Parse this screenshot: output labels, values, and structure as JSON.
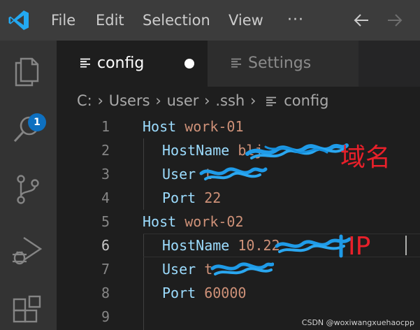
{
  "titlebar": {
    "menus": [
      "File",
      "Edit",
      "Selection",
      "View",
      "···"
    ],
    "back_icon": "arrow-left-icon",
    "forward_icon": "arrow-right-icon"
  },
  "activitybar": {
    "items": [
      {
        "name": "explorer-icon",
        "badge": "1"
      },
      {
        "name": "search-icon"
      },
      {
        "name": "source-control-icon"
      },
      {
        "name": "run-debug-icon"
      },
      {
        "name": "extensions-icon"
      }
    ]
  },
  "tabs": [
    {
      "label": "config",
      "active": true,
      "dirty": true
    },
    {
      "label": "Settings",
      "active": false
    }
  ],
  "breadcrumb": {
    "items": [
      "C:",
      "Users",
      "user",
      ".ssh",
      "config"
    ]
  },
  "editor": {
    "lines": [
      {
        "num": "1",
        "key": "Host",
        "value": "work-01",
        "indent": false
      },
      {
        "num": "2",
        "key": "HostName",
        "value": "blj",
        "indent": true
      },
      {
        "num": "3",
        "key": "User",
        "value": "t",
        "indent": true
      },
      {
        "num": "4",
        "key": "Port",
        "value": "22",
        "indent": true
      },
      {
        "num": "5",
        "key": "Host",
        "value": "work-02",
        "indent": false
      },
      {
        "num": "6",
        "key": "HostName",
        "value": "10.22",
        "indent": true
      },
      {
        "num": "7",
        "key": "User",
        "value": "t",
        "indent": true
      },
      {
        "num": "8",
        "key": "Port",
        "value": "60000",
        "indent": true
      },
      {
        "num": "9",
        "key": "",
        "value": "",
        "indent": false
      }
    ]
  },
  "annotations": {
    "domain": "域名",
    "ip": "IP"
  },
  "watermark": "CSDN @woxiwangxuehaocpp",
  "colors": {
    "keyword": "#9cdcfe",
    "value": "#ce9178",
    "annotation": "#e8202a",
    "badge": "#0e70c0"
  }
}
